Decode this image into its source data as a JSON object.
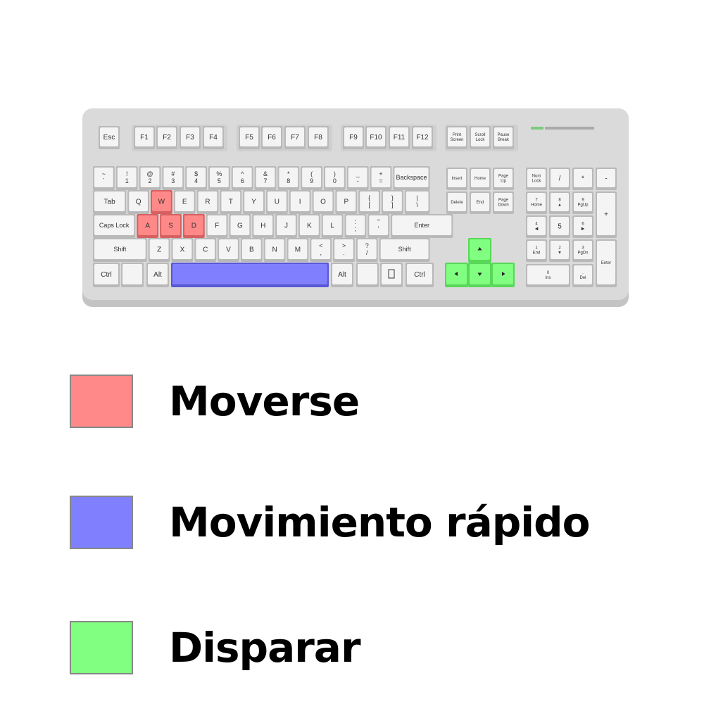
{
  "colors": {
    "move": "#ff8888",
    "dash": "#8080ff",
    "shoot": "#80ff80",
    "key_face": "#f4f4f4",
    "key_edge": "#b9b9b9",
    "keyboard_body": "#d9d9d9"
  },
  "keyboard": {
    "fn_row": [
      "Esc",
      "F1",
      "F2",
      "F3",
      "F4",
      "F5",
      "F6",
      "F7",
      "F8",
      "F9",
      "F10",
      "F11",
      "F12"
    ],
    "sys_keys": [
      "Print\nScreen",
      "Scroll\nLock",
      "Pause\nBreak"
    ],
    "row1": [
      "~\n`",
      "!\n1",
      "@\n2",
      "#\n3",
      "$\n4",
      "%\n5",
      "^\n6",
      "&\n7",
      "*\n8",
      "(\n9",
      ")\n0",
      "_\n-",
      "+\n=",
      "Backspace"
    ],
    "row2": [
      "Tab",
      "Q",
      "W",
      "E",
      "R",
      "T",
      "Y",
      "U",
      "I",
      "O",
      "P",
      "{\n[",
      "}\n]",
      "|\n\\"
    ],
    "row3": [
      "Caps Lock",
      "A",
      "S",
      "D",
      "F",
      "G",
      "H",
      "J",
      "K",
      "L",
      ":\n;",
      "\"\n'",
      "Enter"
    ],
    "row4": [
      "Shift",
      "Z",
      "X",
      "C",
      "V",
      "B",
      "N",
      "M",
      "<\n,",
      ">\n.",
      "?\n/",
      "Shift"
    ],
    "row5": [
      "Ctrl",
      "",
      "Alt",
      "",
      "Alt",
      "",
      "menu-icon",
      "Ctrl"
    ],
    "nav_top": [
      "Insert",
      "Home",
      "Page\nUp",
      "Delete",
      "End",
      "Page\nDown"
    ],
    "arrows": [
      "up-arrow",
      "left-arrow",
      "down-arrow",
      "right-arrow"
    ],
    "numpad": [
      "Num\nLock",
      "/",
      "*",
      "-",
      "7\nHome",
      "8\n▲",
      "9\nPgUp",
      "+",
      "4\n◀",
      "5",
      "6\n▶",
      "1\nEnd",
      "2\n▼",
      "3\nPgDn",
      "Enter",
      "0\nIns",
      ".\nDel"
    ],
    "highlighted": {
      "move": [
        "W",
        "A",
        "S",
        "D"
      ],
      "dash": [
        "Space"
      ],
      "shoot": [
        "up-arrow",
        "left-arrow",
        "down-arrow",
        "right-arrow"
      ]
    }
  },
  "legend": [
    {
      "label": "Moverse",
      "color": "#ff8888"
    },
    {
      "label": "Movimiento rápido",
      "color": "#8080ff"
    },
    {
      "label": "Disparar",
      "color": "#80ff80"
    }
  ]
}
